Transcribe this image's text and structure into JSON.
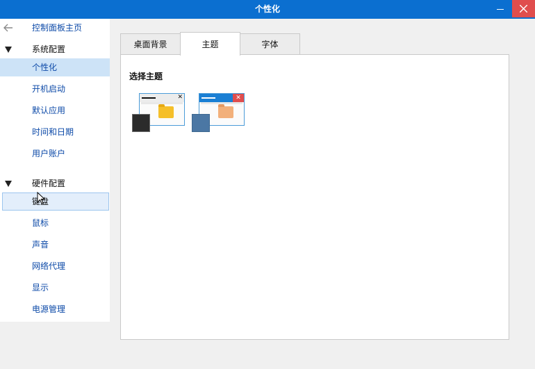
{
  "window": {
    "title": "个性化"
  },
  "sidebar": {
    "back_label": "控制面板主页",
    "groups": [
      {
        "label": "系统配置",
        "items": [
          "个性化",
          "开机启动",
          "默认应用",
          "时间和日期",
          "用户账户"
        ]
      },
      {
        "label": "硬件配置",
        "items": [
          "键盘",
          "鼠标",
          "声音",
          "网络代理",
          "显示",
          "电源管理"
        ]
      }
    ],
    "selected_item": "个性化",
    "hovered_item": "键盘"
  },
  "tabs": [
    "桌面背景",
    "主题",
    "字体"
  ],
  "active_tab": "主题",
  "content": {
    "section_title": "选择主题"
  },
  "themes": [
    {
      "name": "dark",
      "accent": "#2b2b2b",
      "folder_color": "#f5bf2a",
      "titlebar_color": "#ececec"
    },
    {
      "name": "blue",
      "accent": "#4b77a4",
      "folder_color": "#f2b07b",
      "titlebar_color": "#1a7fd4"
    }
  ],
  "colors": {
    "titlebar": "#0b6fd0",
    "close": "#e04d4d",
    "link": "#0d4aa8",
    "selected": "#cde3f7"
  }
}
